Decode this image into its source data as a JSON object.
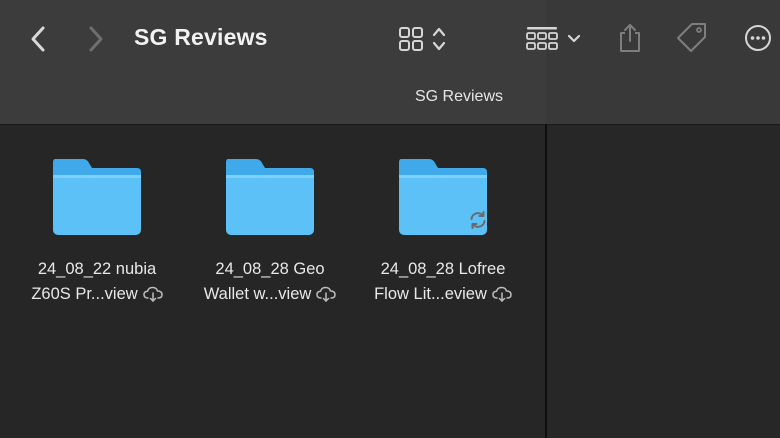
{
  "window": {
    "title": "SG Reviews"
  },
  "path_bar": {
    "label": "SG Reviews"
  },
  "toolbar": {
    "back_icon": "chevron-left-icon",
    "forward_icon": "chevron-right-icon",
    "view_icon": "grid-view-icon",
    "group_icon": "group-by-icon",
    "share_icon": "share-icon",
    "tag_icon": "tag-icon",
    "more_icon": "more-icon"
  },
  "folders": [
    {
      "line1": "24_08_22 nubia",
      "line2": "Z60S Pr...view",
      "status": "cloud-download",
      "syncing": false
    },
    {
      "line1": "24_08_28 Geo",
      "line2": "Wallet w...view",
      "status": "cloud-download",
      "syncing": false
    },
    {
      "line1": "24_08_28 Lofree",
      "line2": "Flow Lit...eview",
      "status": "cloud-download",
      "syncing": true
    }
  ],
  "colors": {
    "folder_blue": "#5cc1f7",
    "folder_tab": "#3fa9ea",
    "toolbar_bg": "#3c3c3c",
    "content_bg": "#262626",
    "icon_gray": "#9a9a9a"
  }
}
